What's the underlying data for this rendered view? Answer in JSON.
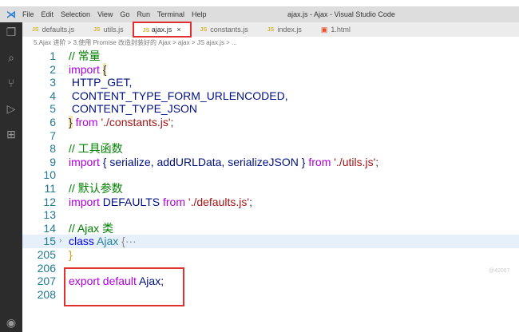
{
  "titlebar": {
    "menu": [
      "File",
      "Edit",
      "Selection",
      "View",
      "Go",
      "Run",
      "Terminal",
      "Help"
    ],
    "title": "ajax.js - Ajax - Visual Studio Code"
  },
  "tabs": [
    {
      "label": "defaults.js",
      "type": "JS"
    },
    {
      "label": "utils.js",
      "type": "JS"
    },
    {
      "label": "ajax.js",
      "type": "JS",
      "active": true
    },
    {
      "label": "constants.js",
      "type": "JS"
    },
    {
      "label": "index.js",
      "type": "JS"
    },
    {
      "label": "1.html",
      "type": "HTML"
    }
  ],
  "close_icon": "×",
  "breadcrumb": "5.Ajax 进阶 > 3.使用 Promise 改造封装好的 Ajax > ajax > JS ajax.js > ...",
  "code": {
    "l1": "// 常量",
    "l2a": "import ",
    "l2b": "{",
    "l3": " HTTP_GET,",
    "l4": " CONTENT_TYPE_FORM_URLENCODED,",
    "l5": " CONTENT_TYPE_JSON",
    "l6a": "}",
    "l6b": " from ",
    "l6c": "'./constants.js'",
    "l6d": ";",
    "l8": "// 工具函数",
    "l9a": "import ",
    "l9b": "{ serialize, addURLData, serializeJSON }",
    "l9c": " from ",
    "l9d": "'./utils.js'",
    "l9e": ";",
    "l11": "// 默认参数",
    "l12a": "import ",
    "l12b": "DEFAULTS",
    "l12c": " from ",
    "l12d": "'./defaults.js'",
    "l12e": ";",
    "l14": "// Ajax 类",
    "l15a": "class ",
    "l15b": "Ajax ",
    "l15c": "{···",
    "l205": "}",
    "l207a": "export default ",
    "l207b": "Ajax;"
  },
  "line_numbers": [
    "1",
    "2",
    "3",
    "4",
    "5",
    "6",
    "7",
    "8",
    "9",
    "10",
    "11",
    "12",
    "13",
    "14",
    "15",
    "205",
    "206",
    "207",
    "208"
  ],
  "watermark": "@42067"
}
